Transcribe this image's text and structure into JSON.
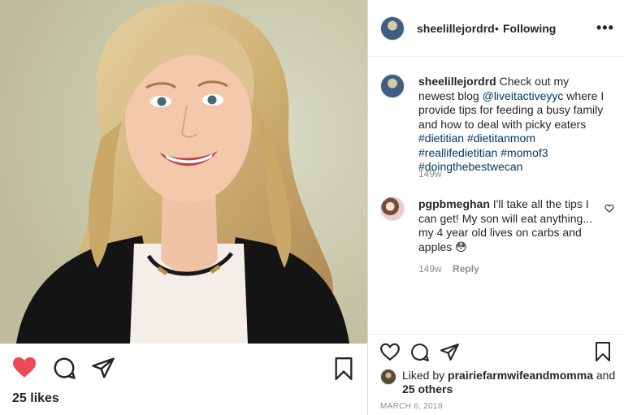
{
  "post": {
    "username": "sheelillejordrd",
    "follow_separator": "•",
    "follow_status": "Following",
    "more_icon": "•••",
    "caption": {
      "text_1": "Check out my newest blog",
      "mention": "@liveitactiveyyc",
      "text_2": "where I provide tips for feeding a busy family and how to deal with picky eaters",
      "hashtags": [
        "#dietitian",
        "#dietitanmom",
        "#reallifedietitian",
        "#momof3",
        "#doingthebestwecan"
      ],
      "age": "149w"
    },
    "comments": [
      {
        "username": "pgpbmeghan",
        "text": "I'll take all the tips I can get! My son will eat anything... my 4 year old lives on carbs and apples",
        "emoji": "😳",
        "age": "149w",
        "reply_label": "Reply"
      }
    ],
    "likes_left": "25 likes",
    "liked_by": {
      "prefix": "Liked by",
      "user": "prairiefarmwifeandmomma",
      "conjunction": "and",
      "others": "25 others"
    },
    "date": "MARCH 6, 2018"
  },
  "colors": {
    "heart_liked": "#ed4956",
    "link": "#00376b",
    "muted": "#8e8e8e",
    "text": "#262626",
    "divider": "#dbdbdb"
  },
  "icons": {
    "like_left": "heart-filled-icon",
    "comment": "comment-bubble-icon",
    "share": "paper-plane-icon",
    "save": "bookmark-icon",
    "like_right": "heart-outline-icon",
    "comment_like": "small-heart-icon"
  }
}
